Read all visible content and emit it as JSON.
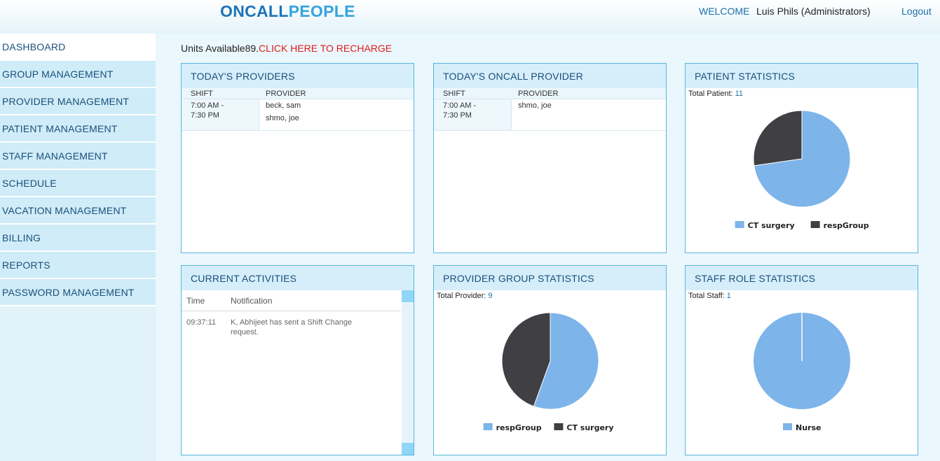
{
  "header": {
    "logo_part1": "ONCALL",
    "logo_part2": "PEOPLE",
    "welcome": "WELCOME",
    "username": "Luis Phils (Administrators)",
    "logout": "Logout"
  },
  "sidebar": {
    "items": [
      {
        "label": "DASHBOARD",
        "active": true
      },
      {
        "label": "GROUP MANAGEMENT"
      },
      {
        "label": "PROVIDER MANAGEMENT"
      },
      {
        "label": "PATIENT MANAGEMENT"
      },
      {
        "label": "STAFF MANAGEMENT"
      },
      {
        "label": "SCHEDULE"
      },
      {
        "label": "VACATION MANAGEMENT"
      },
      {
        "label": "BILLING"
      },
      {
        "label": "REPORTS"
      },
      {
        "label": "PASSWORD MANAGEMENT"
      }
    ]
  },
  "units": {
    "label": "Units Available89.",
    "recharge": "CLICK HERE TO RECHARGE"
  },
  "todays_providers": {
    "title": "TODAY'S PROVIDERS",
    "col_shift": "SHIFT",
    "col_provider": "PROVIDER",
    "shift_line1": "7:00 AM -",
    "shift_line2": "7:30 PM",
    "providers": [
      "beck, sam",
      "shmo, joe"
    ]
  },
  "oncall_provider": {
    "title": "TODAY'S ONCALL PROVIDER",
    "col_shift": "SHIFT",
    "col_provider": "PROVIDER",
    "shift_line1": "7:00 AM -",
    "shift_line2": "7:30 PM",
    "providers": [
      "shmo, joe"
    ]
  },
  "current_activities": {
    "title": "CURRENT ACTIVITIES",
    "col_time": "Time",
    "col_notification": "Notification",
    "rows": [
      {
        "time": "09:37:11",
        "notification": "K, Abhijeet has sent a Shift Change request."
      }
    ]
  },
  "patient_stats": {
    "title": "PATIENT STATISTICS",
    "total_label": "Total Patient:",
    "total_value": "11"
  },
  "provider_group_stats": {
    "title": "PROVIDER GROUP STATISTICS",
    "total_label": "Total Provider:",
    "total_value": "9"
  },
  "staff_role_stats": {
    "title": "STAFF ROLE STATISTICS",
    "total_label": "Total Staff:",
    "total_value": "1"
  },
  "colors": {
    "light_blue": "#7db4ea",
    "dark_gray": "#403f44"
  },
  "chart_data": [
    {
      "type": "pie",
      "categories": [
        "CT surgery",
        "respGroup"
      ],
      "values": [
        8,
        3
      ],
      "colors": [
        "#7db4ea",
        "#403f44"
      ],
      "legend": [
        "CT surgery",
        "respGroup"
      ],
      "start_angle_deg": 0
    },
    {
      "type": "pie",
      "categories": [
        "respGroup",
        "CT surgery"
      ],
      "values": [
        5,
        4
      ],
      "colors": [
        "#7db4ea",
        "#403f44"
      ],
      "legend": [
        "respGroup",
        "CT surgery"
      ],
      "start_angle_deg": 0
    },
    {
      "type": "pie",
      "categories": [
        "Nurse"
      ],
      "values": [
        1
      ],
      "colors": [
        "#7db4ea"
      ],
      "legend": [
        "Nurse"
      ],
      "start_angle_deg": 0
    }
  ]
}
